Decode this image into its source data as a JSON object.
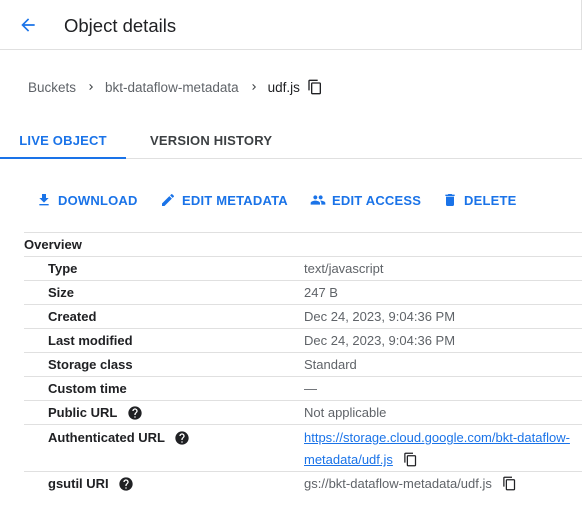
{
  "header": {
    "title": "Object details",
    "back_icon": "arrow-back-icon"
  },
  "breadcrumb": {
    "items": [
      "Buckets",
      "bkt-dataflow-metadata",
      "udf.js"
    ],
    "separator_icon": "chevron-right-icon",
    "copy_icon": "copy-icon"
  },
  "tabs": [
    {
      "label": "LIVE OBJECT",
      "selected": true
    },
    {
      "label": "VERSION HISTORY",
      "selected": false
    }
  ],
  "actions": [
    {
      "label": "DOWNLOAD",
      "icon": "download-icon"
    },
    {
      "label": "EDIT METADATA",
      "icon": "pencil-icon"
    },
    {
      "label": "EDIT ACCESS",
      "icon": "people-icon"
    },
    {
      "label": "DELETE",
      "icon": "trash-icon"
    }
  ],
  "overview": {
    "heading": "Overview",
    "rows": [
      {
        "label": "Type",
        "value": "text/javascript"
      },
      {
        "label": "Size",
        "value": "247 B"
      },
      {
        "label": "Created",
        "value": "Dec 24, 2023, 9:04:36 PM"
      },
      {
        "label": "Last modified",
        "value": "Dec 24, 2023, 9:04:36 PM"
      },
      {
        "label": "Storage class",
        "value": "Standard"
      },
      {
        "label": "Custom time",
        "value": "—"
      },
      {
        "label": "Public URL",
        "value": "Not applicable",
        "help_icon": "help-circle-icon"
      },
      {
        "label": "Authenticated URL",
        "value_line1": "https://storage.cloud.google.com/bkt-dataflow-",
        "value_line2": "metadata/udf.js",
        "help_icon": "help-circle-icon",
        "copy_icon": "copy-icon"
      },
      {
        "label": "gsutil URI",
        "value": "gs://bkt-dataflow-metadata/udf.js",
        "help_icon": "help-circle-icon",
        "copy_icon": "copy-icon"
      }
    ]
  },
  "colors": {
    "accent": "#1a73e8",
    "text": "#202124",
    "secondary_text": "#5f6368",
    "divider": "#e0e0e0"
  }
}
